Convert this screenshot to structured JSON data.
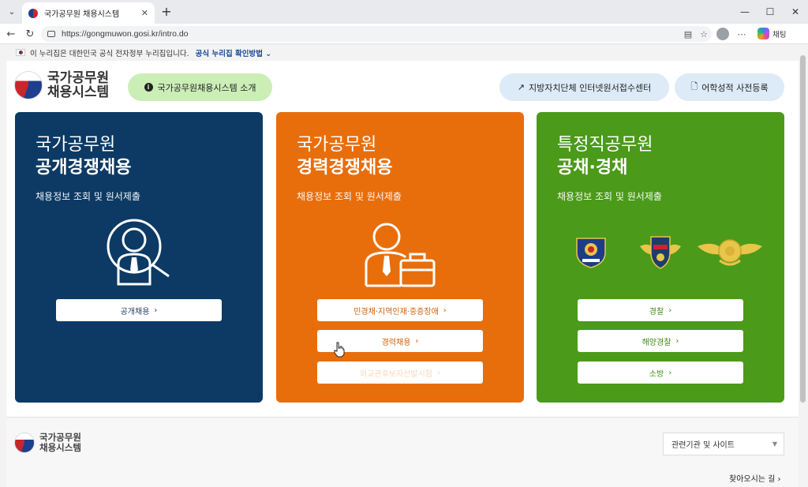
{
  "browser": {
    "tab_title": "국가공무원 채용시스템",
    "url": "https://gongmuwon.gosi.kr/intro.do",
    "chat_label": "채팅"
  },
  "govbar": {
    "notice": "이 누리집은 대한민국 공식 전자정부 누리집입니다.",
    "link": "공식 누리집 확인방법 ⌄"
  },
  "header": {
    "logo_line1": "국가공무원",
    "logo_line2": "채용시스템",
    "intro_button": "국가공무원채용시스템 소개",
    "local_gov_button": "지방자치단체 인터넷원서접수센터",
    "language_button": "어학성적 사전등록"
  },
  "cards": [
    {
      "title1": "국가공무원",
      "title2": "공개경쟁채용",
      "subtitle": "채용정보 조회 및 원서제출",
      "buttons": [
        "공개채용"
      ]
    },
    {
      "title1": "국가공무원",
      "title2": "경력경쟁채용",
      "subtitle": "채용정보 조회 및 원서제출",
      "buttons": [
        "민경채·지역인재·중증장애",
        "경력채용",
        "외교관후보자선발시험"
      ]
    },
    {
      "title1": "특정직공무원",
      "title2": "공채·경채",
      "subtitle": "채용정보 조회 및 원서제출",
      "buttons": [
        "경찰",
        "해양경찰",
        "소방"
      ]
    }
  ],
  "footer": {
    "logo_line1": "국가공무원",
    "logo_line2": "채용시스템",
    "related_select": "관련기관 및 사이트",
    "find_way": "찾아오시는 길  ›"
  },
  "colors": {
    "blue_card": "#0c3a64",
    "orange_card": "#e86e0c",
    "green_card": "#4b9a1a",
    "intro_pill": "#cbeeb6",
    "link_pill": "#dcebf7"
  }
}
